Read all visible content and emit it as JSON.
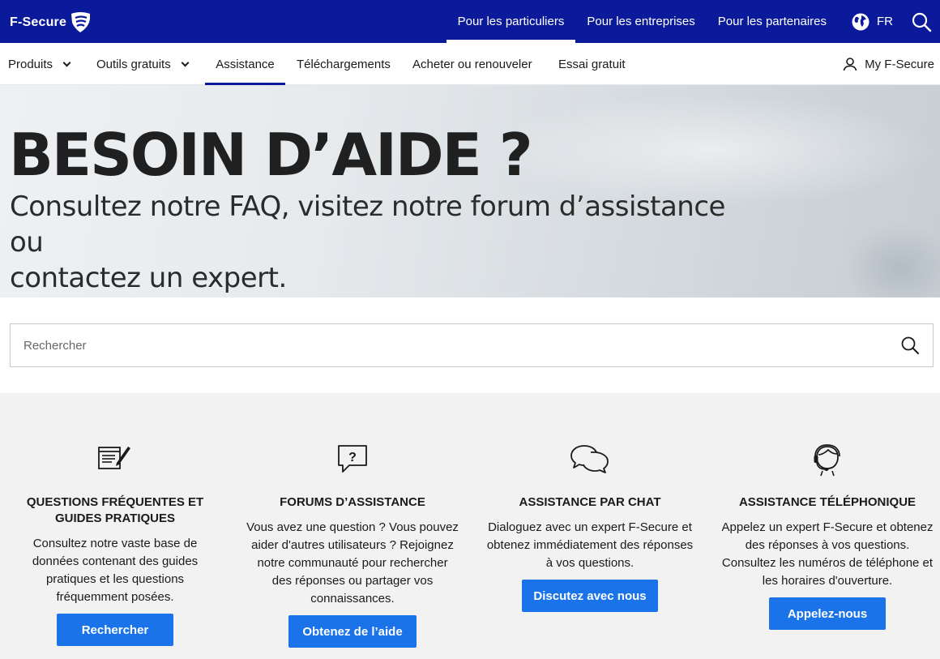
{
  "header": {
    "logo_text": "F-Secure",
    "nav": [
      {
        "label": "Pour les particuliers"
      },
      {
        "label": "Pour les entreprises"
      },
      {
        "label": "Pour les partenaires"
      }
    ],
    "language": "FR"
  },
  "subnav": {
    "items": [
      {
        "label": "Produits"
      },
      {
        "label": "Outils gratuits"
      },
      {
        "label": "Assistance"
      },
      {
        "label": "Téléchargements"
      },
      {
        "label": "Acheter ou renouveler"
      },
      {
        "label": "Essai gratuit"
      }
    ],
    "account_label": "My F-Secure"
  },
  "hero": {
    "title": "BESOIN D’AIDE ?",
    "subtitle_line1": "Consultez notre FAQ, visitez notre forum d’assistance ou",
    "subtitle_line2": "contactez un expert."
  },
  "search": {
    "placeholder": "Rechercher"
  },
  "cards": [
    {
      "icon": "notepad-pen-icon",
      "title_line1": "QUESTIONS FRÉQUENTES ET",
      "title_line2": "GUIDES PRATIQUES",
      "desc": [
        "Consultez notre vaste base de",
        "données contenant des guides",
        "pratiques et les questions",
        "fréquemment posées."
      ],
      "button": "Rechercher"
    },
    {
      "icon": "question-bubble-icon",
      "title_line1": "FORUMS D’ASSISTANCE",
      "desc": [
        "Vous avez une question ? Vous pouvez",
        "aider d'autres utilisateurs ? Rejoignez",
        "notre communauté pour rechercher",
        "des réponses ou partager vos",
        "connaissances."
      ],
      "button": "Obtenez de l’aide"
    },
    {
      "icon": "chat-bubbles-icon",
      "title_line1": "ASSISTANCE PAR CHAT",
      "desc": [
        "Dialoguez avec un expert F-Secure et",
        "obtenez immédiatement des réponses",
        "à vos questions."
      ],
      "button": "Discutez avec nous"
    },
    {
      "icon": "headset-agent-icon",
      "title_line1": "ASSISTANCE TÉLÉPHONIQUE",
      "desc": [
        "Appelez un expert F-Secure et obtenez",
        "des réponses à vos questions.",
        "Consultez les numéros de téléphone et",
        "les horaires d'ouverture."
      ],
      "button": "Appelez-nous"
    }
  ],
  "colors": {
    "brand_navy": "#0a1a9a",
    "button_blue": "#1a73e8",
    "cards_background": "#f2f2f2"
  }
}
